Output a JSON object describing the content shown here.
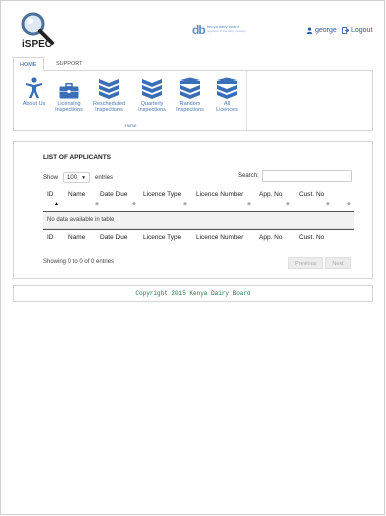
{
  "header": {
    "app_name": "iSPEC",
    "brand_mark": "db",
    "brand_line1": "kenya dairy board",
    "brand_line2": "regulator of the dairy industry",
    "username": "george",
    "logout_label": "Logout"
  },
  "nav": {
    "tabs": [
      {
        "label": "HOME"
      },
      {
        "label": "SUPPORT"
      }
    ],
    "ribbon_buttons": [
      {
        "line1": "About Us",
        "line2": ""
      },
      {
        "line1": "Licensing",
        "line2": "Inspections"
      },
      {
        "line1": "Rescheduled",
        "line2": "Inspections"
      },
      {
        "line1": "Quarterly",
        "line2": "Inspections"
      },
      {
        "line1": "Random",
        "line2": "Inspections"
      },
      {
        "line1": "All",
        "line2": "Licences"
      }
    ],
    "group_label": "Home"
  },
  "applicants": {
    "title": "LIST OF APPLICANTS",
    "show_label": "Show",
    "entries_value": "100",
    "entries_label": "entries",
    "search_label": "Search:",
    "search_value": "",
    "columns": [
      "ID",
      "Name",
      "Date Due",
      "Licence Type",
      "Licence Number",
      "App. No",
      "Cust. No"
    ],
    "empty_message": "No data available in table",
    "info": "Showing 0 to 0 of 0 entries",
    "prev_label": "Previous",
    "next_label": "Next"
  },
  "footer": {
    "copyright": "Copyright 2015 Kenya Dairy Board"
  },
  "colors": {
    "accent": "#2a5ba8",
    "ribbon_icon": "#3a6fb8",
    "footer_text": "#1e7a4a"
  },
  "icons": {
    "logo": "magnifier-icon",
    "user": "user-icon",
    "logout": "logout-icon",
    "about": "person-icon",
    "licensing": "briefcase-icon",
    "stack": "stack-icon"
  }
}
